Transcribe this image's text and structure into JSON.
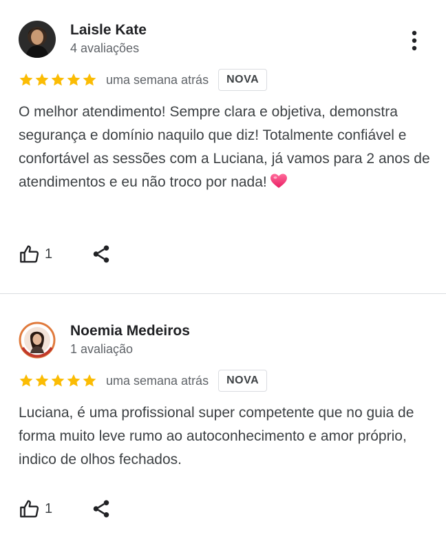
{
  "reviews": [
    {
      "author": "Laisle Kate",
      "review_count": "4 avaliações",
      "rating": 5,
      "time": "uma semana atrás",
      "badge": "NOVA",
      "text": "O melhor atendimento! Sempre clara e objetiva, demonstra segurança e domínio naquilo que diz! Totalmente confiável e confortável as sessões com a Luciana, já vamos para 2 anos de atendimentos e eu não troco por nada!",
      "emoji": "heart-icon",
      "likes": "1"
    },
    {
      "author": "Noemia Medeiros",
      "review_count": "1 avaliação",
      "rating": 5,
      "time": "uma semana atrás",
      "badge": "NOVA",
      "text": "Luciana, é uma profissional super competente que no guia de forma muito leve rumo ao autoconhecimento e amor próprio, indico de olhos fechados.",
      "likes": "1"
    }
  ],
  "colors": {
    "star": "#fbbc04",
    "text": "#3c4043",
    "secondary": "#5f6368",
    "divider": "#dadce0"
  }
}
